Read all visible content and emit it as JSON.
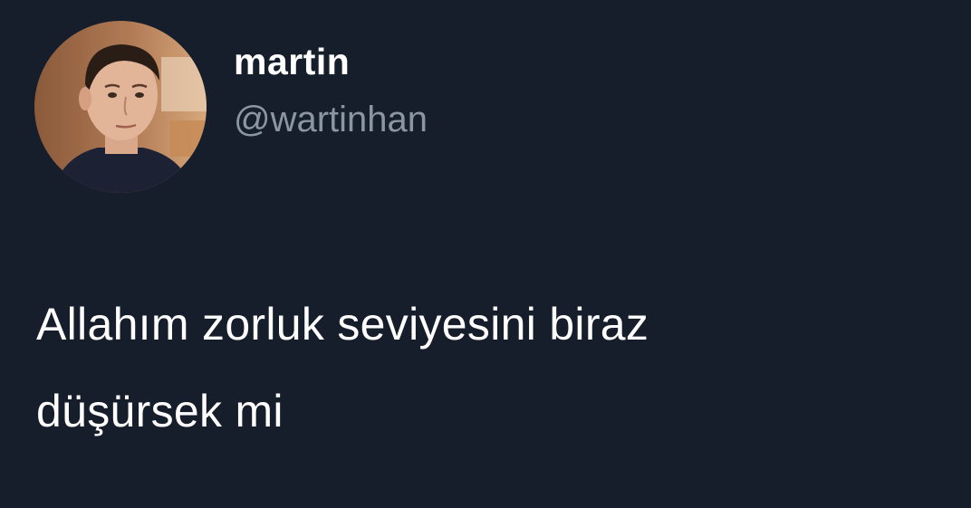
{
  "tweet": {
    "author": {
      "display_name": "martin",
      "handle": "@wartinhan"
    },
    "text_lines": [
      "Allahım zorluk seviyesini biraz",
      "düşürsek mi"
    ]
  },
  "colors": {
    "background": "#161d2b",
    "text": "#ffffff",
    "handle": "#8a96a3"
  }
}
